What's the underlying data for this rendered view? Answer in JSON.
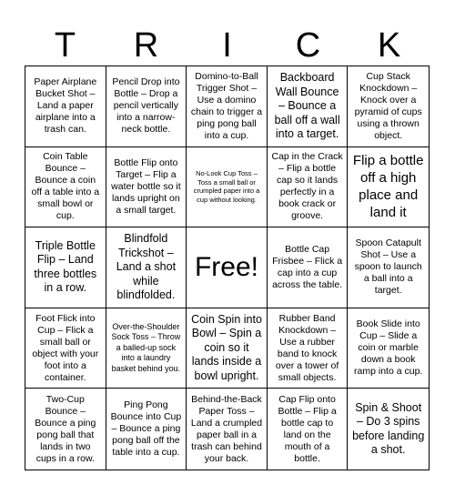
{
  "title_letters": [
    "T",
    "R",
    "I",
    "C",
    "K"
  ],
  "cells": [
    "Paper Airplane Bucket Shot – Land a paper airplane into a trash can.",
    "Pencil Drop into Bottle – Drop a pencil vertically into a narrow-neck bottle.",
    "Domino-to-Ball Trigger Shot – Use a domino chain to trigger a ping pong ball into a cup.",
    "Backboard Wall Bounce – Bounce a ball off a wall into a target.",
    "Cup Stack Knockdown – Knock over a pyramid of cups using a thrown object.",
    "Coin Table Bounce – Bounce a coin off a table into a small bowl or cup.",
    "Bottle Flip onto Target – Flip a water bottle so it lands upright on a small target.",
    "No-Look Cup Toss – Toss a small ball or crumpled paper into a cup without looking.",
    "Cap in the Crack – Flip a bottle cap so it lands perfectly in a book crack or groove.",
    "Flip a bottle off a high place and land it",
    "Triple Bottle Flip – Land three bottles in a row.",
    "Blindfold Trickshot – Land a shot while blindfolded.",
    "Free!",
    "Bottle Cap Frisbee – Flick a cap into a cup across the table.",
    "Spoon Catapult Shot – Use a spoon to launch a ball into a target.",
    "Foot Flick into Cup – Flick a small ball or object with your foot into a container.",
    "Over-the-Shoulder Sock Toss – Throw a balled-up sock into a laundry basket behind you.",
    "Coin Spin into Bowl – Spin a coin so it lands inside a bowl upright.",
    "Rubber Band Knockdown – Use a rubber band to knock over a tower of small objects.",
    "Book Slide into Cup – Slide a coin or marble down a book ramp into a cup.",
    "Two-Cup Bounce – Bounce a ping pong ball that lands in two cups in a row.",
    "Ping Pong Bounce into Cup – Bounce a ping pong ball off the table into a cup.",
    "Behind-the-Back Paper Toss – Land a crumpled paper ball in a trash can behind your back.",
    "Cap Flip onto Bottle – Flip a bottle cap to land on the mouth of a bottle.",
    "Spin & Shoot – Do 3 spins before landing a shot."
  ]
}
